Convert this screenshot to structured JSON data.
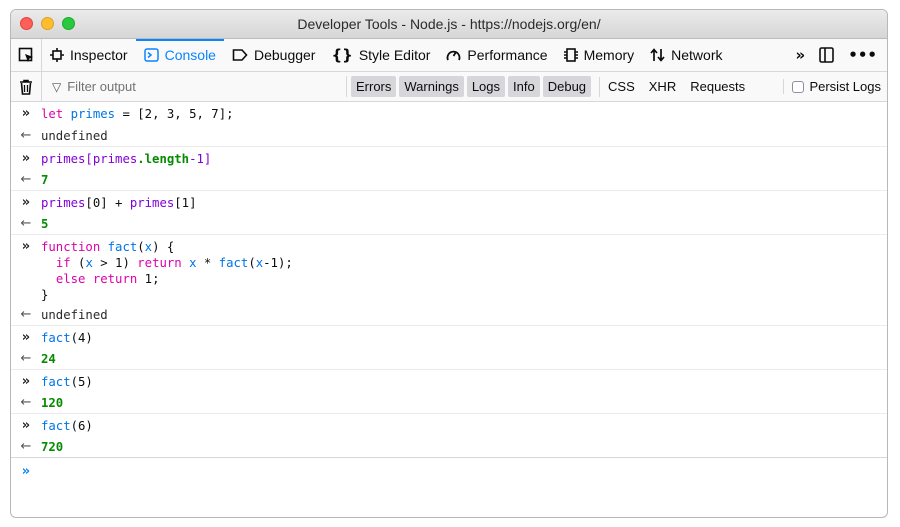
{
  "window": {
    "title": "Developer Tools - Node.js - https://nodejs.org/en/"
  },
  "toolbar": {
    "tabs": [
      {
        "label": "Inspector",
        "icon": "inspector-icon"
      },
      {
        "label": "Console",
        "icon": "console-icon",
        "selected": true
      },
      {
        "label": "Debugger",
        "icon": "debugger-icon"
      },
      {
        "label": "Style Editor",
        "icon": "style-editor-icon"
      },
      {
        "label": "Performance",
        "icon": "performance-icon"
      },
      {
        "label": "Memory",
        "icon": "memory-icon"
      },
      {
        "label": "Network",
        "icon": "network-icon"
      }
    ]
  },
  "filterbar": {
    "filter_placeholder": "Filter output",
    "levels": [
      "Errors",
      "Warnings",
      "Logs",
      "Info",
      "Debug"
    ],
    "net": [
      "CSS",
      "XHR",
      "Requests"
    ],
    "persist_label": "Persist Logs"
  },
  "console": {
    "line1_let": "let",
    "line1_var": "primes",
    "line1_rest": " = [2, 3, 5, 7];",
    "out_undefined": "undefined",
    "line2_a": "primes",
    "line2_b": "[",
    "line2_c": "primes",
    "line2_d": ".length",
    "line2_e": "-1]",
    "out2": "7",
    "line3_a": "primes",
    "line3_b": "[0] + ",
    "line3_c": "primes",
    "line3_d": "[1]",
    "out3": "5",
    "fn_kw": "function",
    "fn_name": "fact",
    "fn_param_open": "(",
    "fn_param": "x",
    "fn_sig_close": ") {",
    "if_kw": "if",
    "if_open": " (",
    "if_x": "x",
    "if_cond": " > 1) ",
    "return_kw": "return",
    "ret_x": "x",
    "ret_mul": " * ",
    "ret_fact": "fact",
    "ret_open": "(",
    "ret_x2": "x",
    "ret_close": "-1);",
    "else_kw": "else",
    "else_return": "return",
    "else_val": " 1;",
    "fn_close": "}",
    "out4": "undefined",
    "call1": "fact",
    "call1_arg": "(4)",
    "out5": "24",
    "call2": "fact",
    "call2_arg": "(5)",
    "out6": "120",
    "call3": "fact",
    "call3_arg": "(6)",
    "out7": "720"
  }
}
